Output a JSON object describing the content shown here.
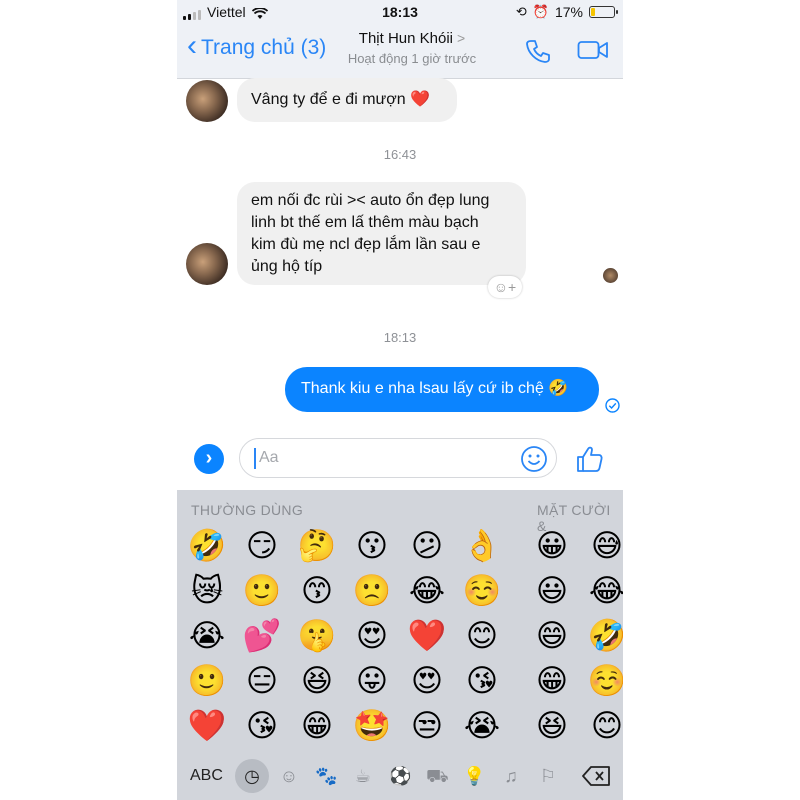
{
  "status_bar": {
    "carrier": "Viettel",
    "time": "18:13",
    "battery": "17%",
    "battery_fraction": 0.17,
    "battery_color": "#f5c400"
  },
  "header": {
    "back_label": "Trang chủ (3)",
    "contact_name": "Thịt Hun Khóii",
    "chevron": ">",
    "activity": "Hoạt động 1 giờ trước",
    "accent_color": "#2a86f6"
  },
  "messages": [
    {
      "direction": "incoming",
      "text": "Vâng ty để e đi mượn ❤️"
    },
    {
      "type": "timestamp",
      "text": "16:43"
    },
    {
      "direction": "incoming",
      "lines": [
        "em nối đc rùi >< auto ổn đẹp lung",
        "linh bt thế em lấ thêm màu bạch",
        "kim đù mẹ ncl đẹp lắm lần sau e",
        "ủng hộ típ"
      ],
      "reaction_placeholder": "☺+"
    },
    {
      "type": "timestamp",
      "text": "18:13"
    },
    {
      "direction": "outgoing",
      "text": "Thank kiu e nha lsau lấy cứ ib chệ 🤣",
      "bubble_color": "#0b84ff"
    }
  ],
  "composer": {
    "placeholder": "Aa",
    "expand_icon": "›"
  },
  "keyboard": {
    "section_frequent": "THƯỜNG DÙNG",
    "section_smileys": "MẶT CƯỜI &",
    "frequent": [
      [
        "🤣",
        "😏",
        "🤔",
        "😗",
        "😕",
        "👌"
      ],
      [
        "😿",
        "🙂",
        "😙",
        "🙁",
        "😂",
        "☺️"
      ],
      [
        "😭",
        "💕",
        "🤫",
        "😍",
        "❤️",
        "😊"
      ],
      [
        "🙂",
        "😑",
        "😆",
        "😛",
        "😍",
        "😘"
      ],
      [
        "❤️",
        "😘",
        "😁",
        "🤩",
        "😒",
        "😭"
      ]
    ],
    "smileys": [
      [
        "😀",
        "😅"
      ],
      [
        "😃",
        "😂"
      ],
      [
        "😄",
        "🤣"
      ],
      [
        "😁",
        "☺️"
      ],
      [
        "😆",
        "😊"
      ]
    ],
    "abc_label": "ABC",
    "categories": [
      "clock-icon",
      "smiley-icon",
      "animal-icon",
      "food-icon",
      "ball-icon",
      "car-icon",
      "bulb-icon",
      "symbols-icon",
      "flag-icon",
      "backspace-icon"
    ]
  }
}
